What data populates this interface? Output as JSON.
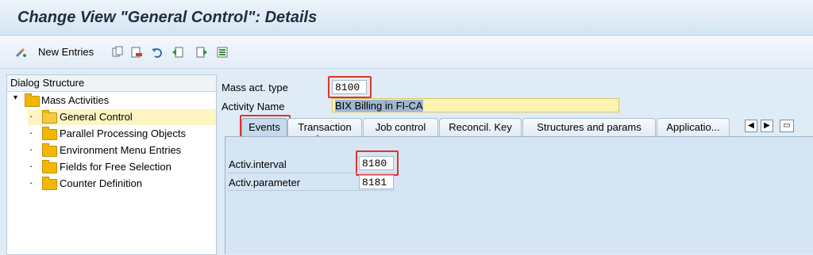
{
  "title": "Change View \"General Control\": Details",
  "toolbar": {
    "new_entries_label": "New Entries",
    "icons": [
      "display-change-icon",
      "copy-icon",
      "delete-icon",
      "undo-icon",
      "previous-entry-icon",
      "next-entry-icon",
      "select-all-icon"
    ]
  },
  "dialog_structure": {
    "header": "Dialog Structure",
    "root": "Mass Activities",
    "items": [
      "General Control",
      "Parallel Processing Objects",
      "Environment Menu Entries",
      "Fields for Free Selection",
      "Counter Definition"
    ],
    "selected": "General Control"
  },
  "fields": {
    "mass_act_type_label": "Mass act. type",
    "mass_act_type_value": "8100",
    "activity_name_label": "Activity Name",
    "activity_name_value": "BIX Billing in FI-CA"
  },
  "tabs": [
    "Events",
    "Transaction",
    "Job control",
    "Reconcil. Key",
    "Structures and params",
    "Applicatio..."
  ],
  "active_tab": "Events",
  "events": {
    "activ_interval_label": "Activ.interval",
    "activ_interval_value": "8180",
    "activ_parameter_label": "Activ.parameter",
    "activ_parameter_value": "8181"
  },
  "colors": {
    "highlight_red": "#e0332e",
    "folder_yellow": "#f2b705",
    "activity_name_bg": "#fdf3b0"
  }
}
